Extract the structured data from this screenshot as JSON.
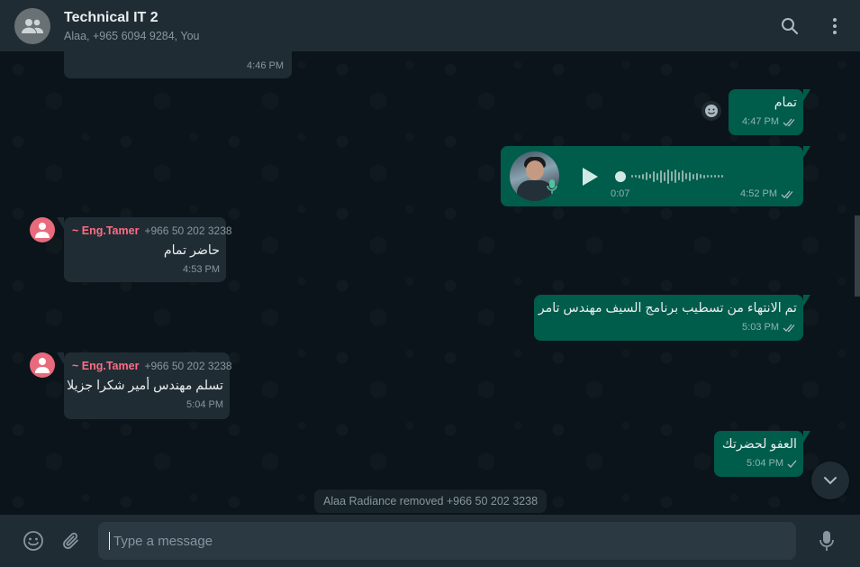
{
  "header": {
    "title": "Technical IT 2",
    "subtitle": "Alaa, +965 6094 9284, You",
    "icons": [
      "group-icon",
      "search-icon",
      "menu-icon"
    ]
  },
  "messages": [
    {
      "id": "m0",
      "direction": "in",
      "time": "4:46 PM"
    },
    {
      "id": "m1",
      "direction": "out",
      "text": "تمام",
      "time": "4:47 PM",
      "ticks": "double",
      "reaction": "smiley-icon"
    },
    {
      "id": "m2",
      "direction": "out",
      "type": "voice",
      "duration": "0:07",
      "time": "4:52 PM",
      "ticks": "double"
    },
    {
      "id": "m3",
      "direction": "in",
      "sender": "~ Eng.Tamer",
      "phone": "+966 50 202 3238",
      "text": "حاضر تمام",
      "time": "4:53 PM"
    },
    {
      "id": "m4",
      "direction": "out",
      "text": "تم الانتهاء من تسطيب برنامج السيف مهندس تامر",
      "time": "5:03 PM",
      "ticks": "double"
    },
    {
      "id": "m5",
      "direction": "in",
      "sender": "~ Eng.Tamer",
      "phone": "+966 50 202 3238",
      "text": "تسلم مهندس أمير شكرا جزيلا",
      "time": "5:04 PM"
    },
    {
      "id": "m6",
      "direction": "out",
      "text": "العفو لحضرتك",
      "time": "5:04 PM",
      "ticks": "single"
    }
  ],
  "system_message": "Alaa Radiance removed +966 50 202 3238",
  "footer": {
    "placeholder": "Type a message",
    "icons": [
      "emoji-icon",
      "attach-icon",
      "mic-icon"
    ]
  },
  "colors": {
    "header_bg": "#202c33",
    "chat_bg": "#0b141a",
    "incoming_bubble": "#202c33",
    "outgoing_bubble": "#005c4b",
    "sender_name": "#fc6c85"
  }
}
